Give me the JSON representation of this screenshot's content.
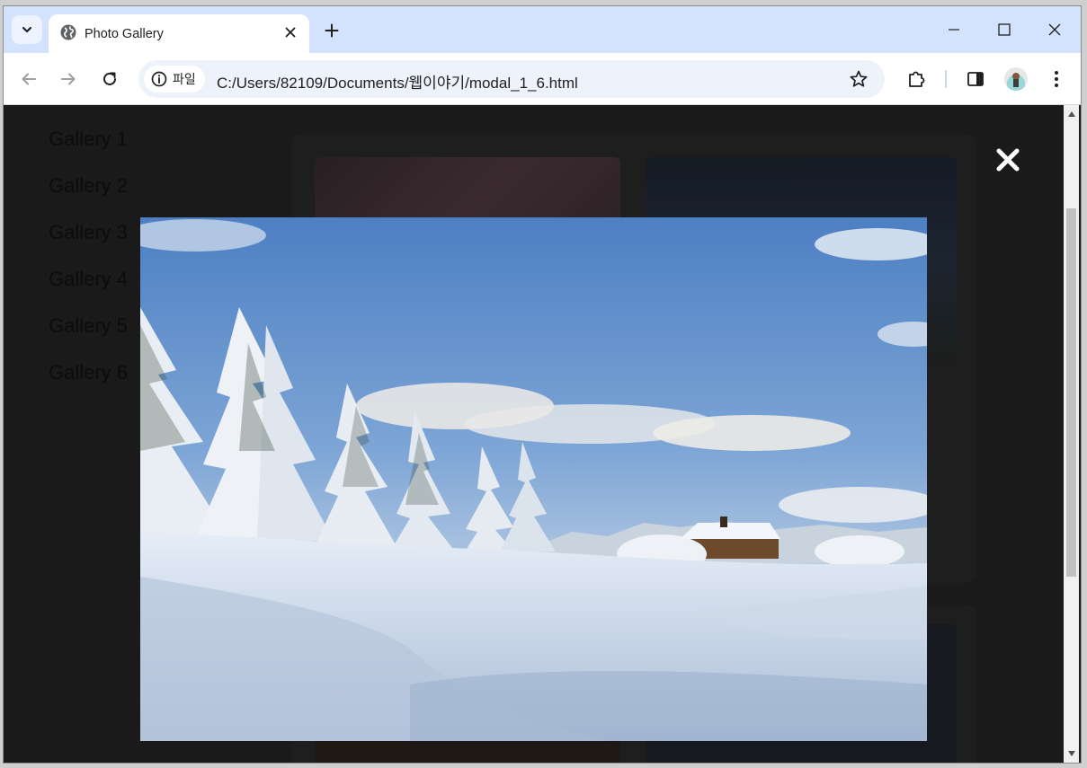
{
  "tab": {
    "title": "Photo Gallery"
  },
  "toolbar": {
    "chip_label": "파일",
    "url": "C:/Users/82109/Documents/웹이야기/modal_1_6.html"
  },
  "sidebar": {
    "items": [
      {
        "label": "Gallery 1"
      },
      {
        "label": "Gallery 2"
      },
      {
        "label": "Gallery 3"
      },
      {
        "label": "Gallery 4"
      },
      {
        "label": "Gallery 5"
      },
      {
        "label": "Gallery 6"
      }
    ]
  },
  "icons": {
    "tab_search": "chevron-down-icon",
    "tab_favicon": "globe-icon",
    "tab_close": "close-icon",
    "new_tab": "plus-icon",
    "minimize": "minimize-icon",
    "maximize": "maximize-icon",
    "window_close": "close-icon",
    "back": "arrow-left-icon",
    "forward": "arrow-right-icon",
    "reload": "reload-icon",
    "info": "info-icon",
    "bookmark": "star-icon",
    "extensions": "puzzle-icon",
    "side_panel": "side-panel-icon",
    "menu": "more-vert-icon",
    "modal_close": "close-icon"
  },
  "colors": {
    "tabstrip": "#d3e3fd",
    "overlay": "#1a1a1a",
    "modal_close": "#ffffff"
  }
}
